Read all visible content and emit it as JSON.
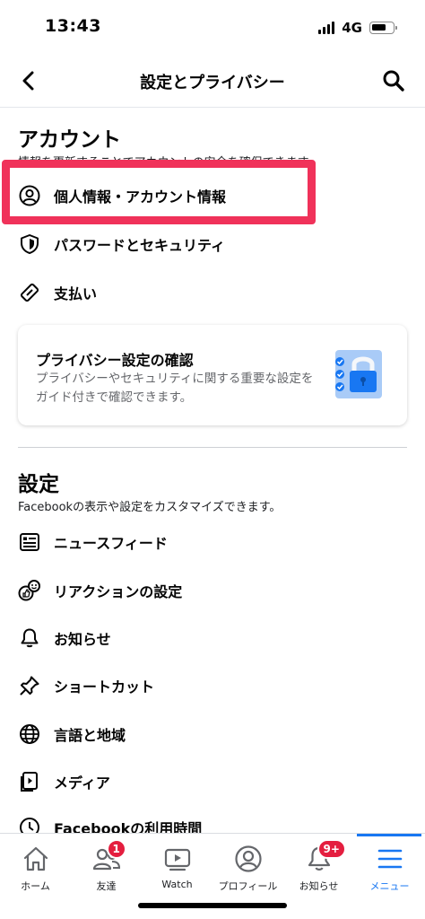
{
  "status_bar": {
    "time": "13:43",
    "network": "4G"
  },
  "header": {
    "title": "設定とプライバシー"
  },
  "account": {
    "title": "アカウント",
    "subtitle": "情報を更新することでアカウントの安全を確保できます。",
    "items": [
      {
        "label": "個人情報・アカウント情報",
        "icon": "person-circle-icon"
      },
      {
        "label": "パスワードとセキュリティ",
        "icon": "shield-icon"
      },
      {
        "label": "支払い",
        "icon": "tag-icon"
      }
    ]
  },
  "privacy_card": {
    "title": "プライバシー設定の確認",
    "description": "プライバシーやセキュリティに関する重要な設定をガイド付きで確認できます。",
    "icon": "lock-checklist-icon"
  },
  "settings": {
    "title": "設定",
    "subtitle": "Facebookの表示や設定をカスタマイズできます。",
    "items": [
      {
        "label": "ニュースフィード",
        "icon": "news-feed-icon"
      },
      {
        "label": "リアクションの設定",
        "icon": "reaction-icon"
      },
      {
        "label": "お知らせ",
        "icon": "bell-icon"
      },
      {
        "label": "ショートカット",
        "icon": "pin-icon"
      },
      {
        "label": "言語と地域",
        "icon": "globe-icon"
      },
      {
        "label": "メディア",
        "icon": "media-icon"
      },
      {
        "label": "Facebookの利用時間",
        "icon": "clock-icon"
      }
    ]
  },
  "bottom_nav": {
    "items": [
      {
        "label": "ホーム",
        "icon": "home-icon"
      },
      {
        "label": "友達",
        "icon": "friends-icon",
        "badge": "1"
      },
      {
        "label": "Watch",
        "icon": "watch-icon"
      },
      {
        "label": "プロフィール",
        "icon": "profile-icon"
      },
      {
        "label": "お知らせ",
        "icon": "bell-icon",
        "badge": "9+"
      },
      {
        "label": "メニュー",
        "icon": "menu-icon",
        "active": true
      }
    ]
  },
  "colors": {
    "accent": "#1877f2",
    "badge": "#e41e3f",
    "highlight": "#f0325a"
  }
}
